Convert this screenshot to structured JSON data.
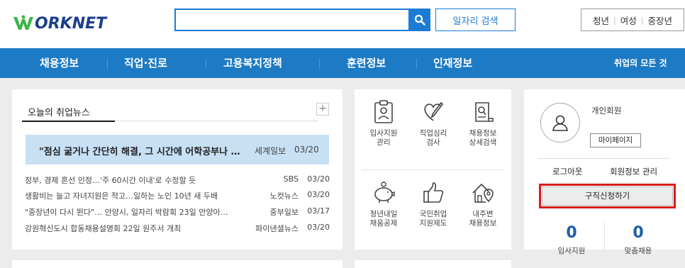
{
  "header": {
    "logo_text": "ORKNET",
    "search": {
      "value": "",
      "placeholder": ""
    },
    "job_search_label": "일자리 검색",
    "quick_links": [
      "청년",
      "여성",
      "중장년"
    ]
  },
  "nav": {
    "items": [
      "채용정보",
      "직업·진로",
      "고용복지정책",
      "훈련정보",
      "인재정보"
    ],
    "right_label": "취업의 모든 것"
  },
  "news": {
    "tab_label": "오늘의 취업뉴스",
    "plus_label": "+",
    "headline": {
      "title": "\"점심 굶거나 간단히 해결, 그 시간에 어학공부나 …",
      "source": "세계일보",
      "date": "03/20"
    },
    "items": [
      {
        "title": "정부, 경제 혼선 인정…'주 60시간 이내'로 수정할 듯",
        "source": "SBS",
        "date": "03/20"
      },
      {
        "title": "생활비는 늘고 자녀지원은 적고…일하는 노인 10년 새 두배",
        "source": "노컷뉴스",
        "date": "03/20"
      },
      {
        "title": "\"중장년이 다시 뛴다\"… 안양시, 일자리 박람회 23일 안양아…",
        "source": "중부일보",
        "date": "03/17"
      },
      {
        "title": "강원혁신도시 합동채용설명회 22일 원주서 개최",
        "source": "파이낸셜뉴스",
        "date": "03/20"
      }
    ]
  },
  "services": [
    {
      "label1": "입사지원",
      "label2": "관리",
      "icon": "clipboard-user-icon"
    },
    {
      "label1": "직업심리",
      "label2": "검사",
      "icon": "heart-pencil-icon"
    },
    {
      "label1": "채용정보",
      "label2": "상세검색",
      "icon": "document-search-icon"
    },
    {
      "label1": "청년내일",
      "label2": "채움공제",
      "icon": "piggy-bank-icon"
    },
    {
      "label1": "국민취업",
      "label2": "지원제도",
      "icon": "thumbs-up-icon"
    },
    {
      "label1": "내주변",
      "label2": "채용정보",
      "icon": "house-location-icon"
    }
  ],
  "member": {
    "label": "개인회원",
    "mypage_label": "마이페이지",
    "logout_label": "로그아웃",
    "info_label": "회원정보 관리",
    "apply_label": "구직신청하기",
    "counts": [
      {
        "value": "0",
        "label": "입사지원"
      },
      {
        "value": "0",
        "label": "맞춤채용"
      }
    ]
  },
  "colors": {
    "brand_blue": "#1d7ac4",
    "search_blue": "#1c7cd5",
    "highlight": "#d91b1b",
    "logo_green": "#3bb54a"
  }
}
